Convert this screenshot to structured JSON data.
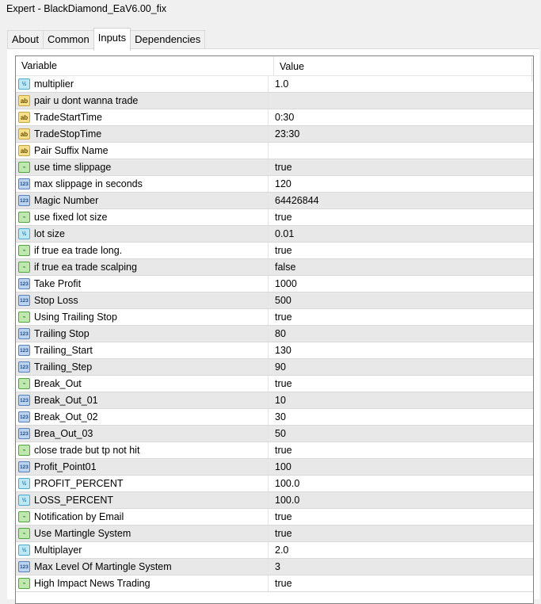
{
  "window": {
    "title": "Expert - BlackDiamond_EaV6.00_fix"
  },
  "tabs": [
    {
      "label": "About"
    },
    {
      "label": "Common"
    },
    {
      "label": "Inputs"
    },
    {
      "label": "Dependencies"
    }
  ],
  "active_tab": "Inputs",
  "table": {
    "headers": {
      "variable": "Variable",
      "value": "Value"
    },
    "rows": [
      {
        "type": "double",
        "icon": "½",
        "name": "multiplier",
        "value": "1.0"
      },
      {
        "type": "string",
        "icon": "ab",
        "name": "pair u dont wanna trade",
        "value": ""
      },
      {
        "type": "string",
        "icon": "ab",
        "name": "TradeStartTime",
        "value": "0:30"
      },
      {
        "type": "string",
        "icon": "ab",
        "name": "TradeStopTime",
        "value": "23:30"
      },
      {
        "type": "string",
        "icon": "ab",
        "name": "Pair Suffix Name",
        "value": ""
      },
      {
        "type": "bool",
        "icon": "⌁",
        "name": "use time slippage",
        "value": "true"
      },
      {
        "type": "int",
        "icon": "123",
        "name": "max slippage in seconds",
        "value": "120"
      },
      {
        "type": "int",
        "icon": "123",
        "name": "Magic Number",
        "value": "64426844"
      },
      {
        "type": "bool",
        "icon": "⌁",
        "name": "use fixed lot size",
        "value": "true"
      },
      {
        "type": "double",
        "icon": "½",
        "name": "lot size",
        "value": "0.01"
      },
      {
        "type": "bool",
        "icon": "⌁",
        "name": "if true ea trade long.",
        "value": "true"
      },
      {
        "type": "bool",
        "icon": "⌁",
        "name": "if true ea trade scalping",
        "value": "false"
      },
      {
        "type": "int",
        "icon": "123",
        "name": "Take Profit",
        "value": "1000"
      },
      {
        "type": "int",
        "icon": "123",
        "name": "Stop Loss",
        "value": "500"
      },
      {
        "type": "bool",
        "icon": "⌁",
        "name": "Using Trailing Stop",
        "value": "true"
      },
      {
        "type": "int",
        "icon": "123",
        "name": "Trailing Stop",
        "value": "80"
      },
      {
        "type": "int",
        "icon": "123",
        "name": "Trailing_Start",
        "value": "130"
      },
      {
        "type": "int",
        "icon": "123",
        "name": "Trailing_Step",
        "value": "90"
      },
      {
        "type": "bool",
        "icon": "⌁",
        "name": "Break_Out",
        "value": "true"
      },
      {
        "type": "int",
        "icon": "123",
        "name": "Break_Out_01",
        "value": "10"
      },
      {
        "type": "int",
        "icon": "123",
        "name": "Break_Out_02",
        "value": "30"
      },
      {
        "type": "int",
        "icon": "123",
        "name": "Brea_Out_03",
        "value": "50"
      },
      {
        "type": "bool",
        "icon": "⌁",
        "name": "close trade but tp not hit",
        "value": "true"
      },
      {
        "type": "int",
        "icon": "123",
        "name": "Profit_Point01",
        "value": "100"
      },
      {
        "type": "double",
        "icon": "½",
        "name": "PROFIT_PERCENT",
        "value": "100.0"
      },
      {
        "type": "double",
        "icon": "½",
        "name": "LOSS_PERCENT",
        "value": "100.0"
      },
      {
        "type": "bool",
        "icon": "⌁",
        "name": "Notification by Email",
        "value": "true"
      },
      {
        "type": "bool",
        "icon": "⌁",
        "name": "Use Martingle System",
        "value": "true"
      },
      {
        "type": "double",
        "icon": "½",
        "name": "Multiplayer",
        "value": "2.0"
      },
      {
        "type": "int",
        "icon": "123",
        "name": "Max Level Of Martingle System",
        "value": "3"
      },
      {
        "type": "bool",
        "icon": "⌁",
        "name": "High Impact News Trading",
        "value": "true"
      }
    ]
  }
}
